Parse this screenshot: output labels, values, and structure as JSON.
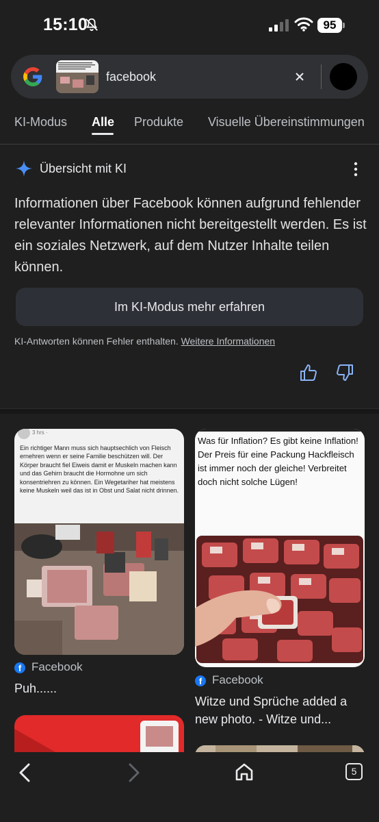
{
  "status_bar": {
    "time": "15:10",
    "battery": "95",
    "icons": [
      "bell-muted-icon",
      "cellular-signal-icon",
      "wifi-icon",
      "battery-icon"
    ]
  },
  "search": {
    "query": "facebook",
    "thumbnail_icon": "image-thumbnail",
    "clear_icon": "close-icon"
  },
  "tabs": [
    {
      "label": "KI-Modus"
    },
    {
      "label": "Alle",
      "active": true
    },
    {
      "label": "Produkte"
    },
    {
      "label": "Visuelle Übereinstimmungen"
    }
  ],
  "ai_overview": {
    "title": "Übersicht mit KI",
    "text": "Informationen über Facebook können aufgrund fehlender relevanter Informationen nicht bereitgestellt werden. Es ist ein soziales Netzwerk, auf dem Nutzer Inhalte teilen können.",
    "button_label": "Im KI-Modus mehr erfahren",
    "disclaimer": "KI-Antworten können Fehler enthalten.",
    "disclaimer_link": "Weitere Informationen"
  },
  "results": [
    {
      "source": "Facebook",
      "title": "Puh......",
      "image_meta": "3 hrs ·",
      "image_text": "Ein richtiger Mann muss sich hauptsechlich von Fleisch ernehren wenn er seine Familie beschützen will. Der Körper braucht fiel Eiweis damit er Muskeln machen kann und das Gehirn braucht die Hormohne um sich konsentriehren zu können. Ein Wegetariher hat meistens keine Muskeln weil das ist in Obst und Salat nicht drinnen."
    },
    {
      "source": "Facebook",
      "title": "Witze und Sprüche added a new photo. - Witze und...",
      "image_text": "Was für Inflation? Es gibt keine Inflation! Der Preis für eine Packung Hackfleisch ist immer noch der gleiche! Verbreitet doch nicht solche Lügen!"
    }
  ],
  "bottom_nav": {
    "tab_count": "5"
  },
  "colors": {
    "background": "#1f1f1f",
    "search_bar": "#303134",
    "facebook_blue": "#1877f2",
    "ai_sparkle": "#4a8ef5",
    "button_bg": "#2e3038"
  }
}
